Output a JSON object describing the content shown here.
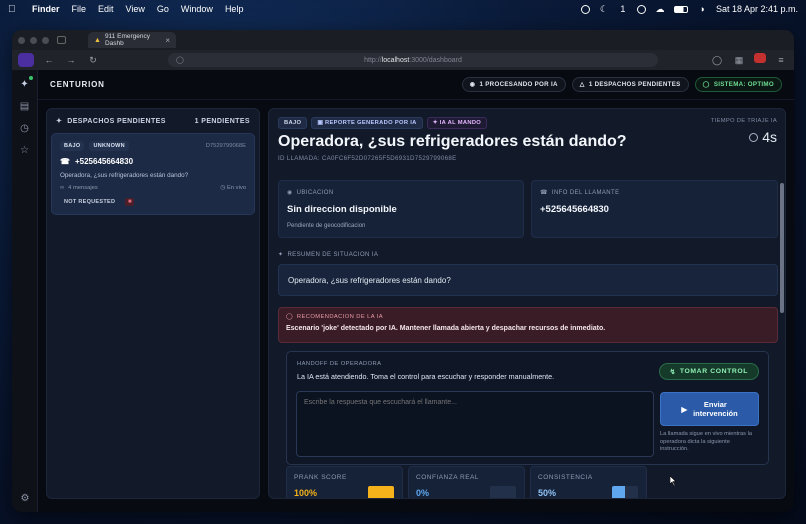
{
  "menubar": {
    "app": "Finder",
    "items": [
      "File",
      "Edit",
      "View",
      "Go",
      "Window",
      "Help"
    ],
    "notification_count": "1",
    "datetime": "Sat 18 Apr  2:41 p.m."
  },
  "browser": {
    "tab_title": "911 Emergency Dashb",
    "url_scheme": "http://",
    "url_host": "localhost",
    "url_path": ":3000/dashboard"
  },
  "app": {
    "brand": "CENTURION",
    "pills": {
      "processing": "1 PROCESANDO POR IA",
      "pending": "1 DESPACHOS PENDIENTES",
      "system": "SISTEMA: OPTIMO"
    }
  },
  "list": {
    "title": "DESPACHOS PENDIENTES",
    "count": "1 PENDIENTES",
    "card": {
      "priority": "BAJO",
      "type": "UNKNOWN",
      "id": "D7529799068E",
      "phone": "+525645664830",
      "text": "Operadora, ¿sus refrigeradores están dando?",
      "messages": "4 mensajes",
      "live": "En vivo",
      "status": "NOT REQUESTED"
    }
  },
  "detail": {
    "tags": {
      "priority": "BAJO",
      "report": "REPORTE GENERADO POR IA",
      "ai": "IA AL MANDO"
    },
    "title": "Operadora, ¿sus refrigeradores están dando?",
    "call_id": "ID LLAMADA: CA0FC6F52D07265F5D6931D7529799068E",
    "triage_label": "TIEMPO DE TRIAJE IA",
    "triage_value": "4s",
    "location": {
      "label": "UBICACION",
      "value": "Sin direccion disponible",
      "sub": "Pendiente de geocodificacion"
    },
    "caller": {
      "label": "INFO DEL LLAMANTE",
      "value": "+525645664830"
    },
    "summary_label": "RESUMEN DE SITUACION IA",
    "summary": "Operadora, ¿sus refrigeradores están dando?",
    "recommendation": {
      "label": "RECOMENDACION DE LA IA",
      "text": "Escenario 'joke' detectado por IA. Mantener llamada abierta y despachar recursos de inmediato."
    },
    "handoff": {
      "label": "HANDOFF DE OPERADORA",
      "text": "La IA está atendiendo. Toma el control para escuchar y responder manualmente.",
      "take_control": "TOMAR CONTROL",
      "placeholder": "Escribe la respuesta que escuchará el llamante...",
      "send_line1": "Enviar",
      "send_line2": "intervención",
      "note": "La llamada sigue en vivo mientras la operadora dicta la siguiente instrucción."
    },
    "metrics": [
      {
        "label": "PRANK SCORE",
        "value": "100%",
        "fill": 1.0,
        "color": "#f5b21a"
      },
      {
        "label": "CONFIANZA REAL",
        "value": "0%",
        "fill": 0.0,
        "color": "#2d6fd1"
      },
      {
        "label": "CONSISTENCIA",
        "value": "50%",
        "fill": 0.5,
        "color": "#5fa8f0"
      }
    ]
  },
  "colors": {
    "accent": "#2a5aa8",
    "ok": "#6fdc94",
    "danger": "#3a1c27"
  }
}
